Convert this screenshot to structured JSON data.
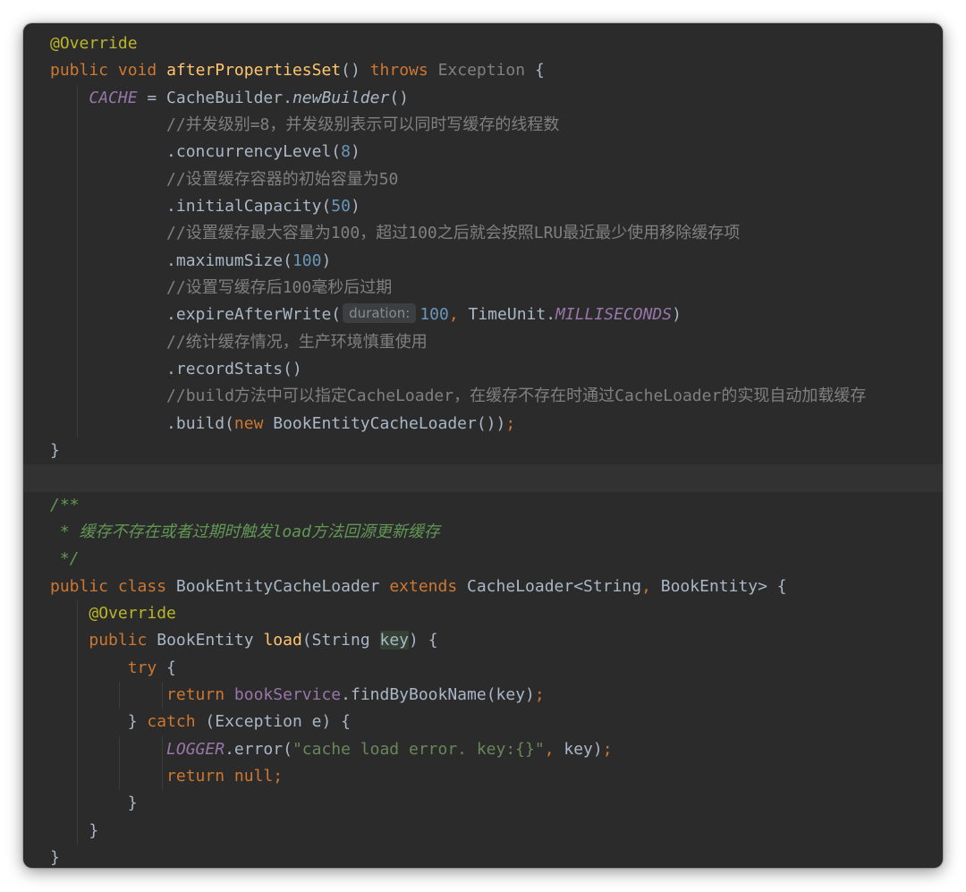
{
  "editor": {
    "l1_annotation": "@Override",
    "l2_public": "public",
    "l2_void": "void",
    "l2_method": "afterPropertiesSet",
    "l2_parens": "()",
    "l2_throws": "throws",
    "l2_exception": "Exception",
    "l2_brace": "{",
    "l3_cache": "CACHE",
    "l3_eq": " = CacheBuilder.",
    "l3_newbuilder": "newBuilder",
    "l3_parens": "()",
    "l4_comment": "//并发级别=8，并发级别表示可以同时写缓存的线程数",
    "l5_call": ".concurrencyLevel(",
    "l5_num": "8",
    "l5_close": ")",
    "l6_comment": "//设置缓存容器的初始容量为50",
    "l7_call": ".initialCapacity(",
    "l7_num": "50",
    "l7_close": ")",
    "l8_comment": "//设置缓存最大容量为100，超过100之后就会按照LRU最近最少使用移除缓存项",
    "l9_call": ".maximumSize(",
    "l9_num": "100",
    "l9_close": ")",
    "l10_comment": "//设置写缓存后100毫秒后过期",
    "l11_call": ".expireAfterWrite(",
    "l11_hint": "duration:",
    "l11_num": "100",
    "l11_comma": ",",
    "l11_timeunit": " TimeUnit.",
    "l11_ms": "MILLISECONDS",
    "l11_close": ")",
    "l12_comment": "//统计缓存情况，生产环境慎重使用",
    "l13_call": ".recordStats()",
    "l14_comment": "//build方法中可以指定CacheLoader，在缓存不存在时通过CacheLoader的实现自动加载缓存",
    "l15_call": ".build(",
    "l15_new": "new",
    "l15_rest": " BookEntityCacheLoader())",
    "l15_semi": ";",
    "l16_brace": "}",
    "l18_doc": "/**",
    "l19_doc_a": " * 缓存不存在或者过期时触发",
    "l19_doc_load": "load",
    "l19_doc_b": "方法回源更新缓存",
    "l20_doc": " */",
    "l21_public": "public",
    "l21_class": "class",
    "l21_name": " BookEntityCacheLoader ",
    "l21_extends": "extends",
    "l21_super": " CacheLoader<String",
    "l21_comma": ",",
    "l21_rest": " BookEntity> {",
    "l22_annotation": "@Override",
    "l23_public": "public",
    "l23_type": " BookEntity ",
    "l23_method": "load",
    "l23_open": "(String ",
    "l23_key": "key",
    "l23_close": ") {",
    "l24_try": "try",
    "l24_brace": " {",
    "l25_return": "return",
    "l25_field": "bookService",
    "l25_call": ".findByBookName(key)",
    "l25_semi": ";",
    "l26_close": "} ",
    "l26_catch": "catch",
    "l26_rest": " (Exception e) {",
    "l27_logger": "LOGGER",
    "l27_call": ".error(",
    "l27_str": "\"cache load error. key:{}\"",
    "l27_comma": ",",
    "l27_rest": " key)",
    "l27_semi": ";",
    "l28_return": "return",
    "l28_null": "null",
    "l28_semi": ";",
    "l29_brace": "}",
    "l30_brace": "}",
    "l31_brace": "}"
  },
  "colors": {
    "background": "#2b2b2b",
    "keyword": "#cc7832",
    "annotation": "#bbb529",
    "method": "#ffc66d",
    "static_field": "#9876aa",
    "number": "#6897bb",
    "comment": "#808080",
    "doc_comment": "#629755",
    "string": "#6a8759",
    "default_text": "#a9b7c6"
  }
}
